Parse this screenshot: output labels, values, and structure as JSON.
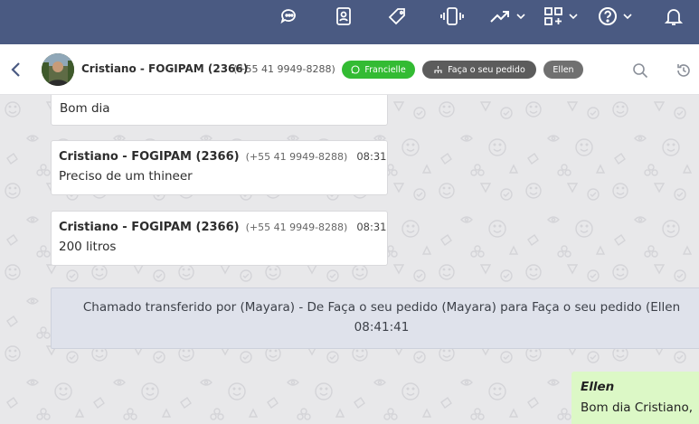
{
  "topbar": {
    "icons": [
      "chat-bubbles-icon",
      "contacts-book-icon",
      "tag-icon",
      "phone-vibrate-icon",
      "trending-up-icon",
      "apps-grid-icon",
      "help-circle-icon",
      "bell-icon"
    ]
  },
  "header": {
    "contact_name": "Cristiano - FOGIPAM (2366)",
    "contact_phone": "(+55 41 9949-8288)",
    "tags": [
      {
        "label": "Francielle",
        "color": "#33bb33",
        "icon": "whatsapp-icon"
      },
      {
        "label": "Faça o seu pedido",
        "color": "#5c5c5c",
        "icon": "org-chart-icon"
      },
      {
        "label": "Ellen",
        "color": "#707070"
      }
    ]
  },
  "messages": [
    {
      "text": "Bom dia"
    },
    {
      "sender": "Cristiano - FOGIPAM (2366)",
      "phone": "(+55 41 9949-8288)",
      "time": "08:31",
      "text": "Preciso de um thineer"
    },
    {
      "sender": "Cristiano - FOGIPAM (2366)",
      "phone": "(+55 41 9949-8288)",
      "time": "08:31",
      "text": "200 litros"
    }
  ],
  "system_message": {
    "text": "Chamado transferido por (Mayara) - De Faça o seu pedido (Mayara) para Faça o seu pedido (Ellen",
    "time": "08:41:41"
  },
  "outgoing": {
    "sender": "Ellen",
    "text": "Bom dia Cristiano,"
  },
  "colors": {
    "topbar": "#4a5a82",
    "green_tag": "#33bb33",
    "outgoing_bubble": "#dcf8c6",
    "system_bg": "#dfe2eb"
  }
}
